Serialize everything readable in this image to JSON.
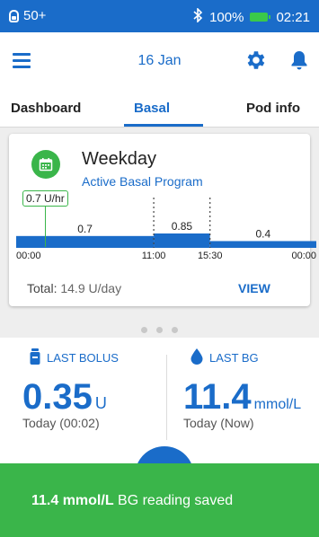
{
  "status_bar": {
    "pod_count": "50+",
    "battery": "100%",
    "time": "02:21"
  },
  "header": {
    "date": "16 Jan"
  },
  "tabs": [
    {
      "label": "Dashboard"
    },
    {
      "label": "Basal"
    },
    {
      "label": "Pod info"
    }
  ],
  "basal_card": {
    "program_name": "Weekday",
    "program_status": "Active Basal Program",
    "current_rate": "0.7 U/hr",
    "total_label": "Total:",
    "total_value": "14.9 U/day",
    "view_label": "VIEW"
  },
  "chart_data": {
    "type": "step",
    "segments": [
      {
        "start": "00:00",
        "end": "11:00",
        "rate": 0.7
      },
      {
        "start": "11:00",
        "end": "15:30",
        "rate": 0.85
      },
      {
        "start": "15:30",
        "end": "24:00",
        "rate": 0.4
      }
    ],
    "tick_labels": [
      "00:00",
      "11:00",
      "15:30",
      "00:00"
    ],
    "value_labels": [
      "0.7",
      "0.85",
      "0.4"
    ],
    "color": "#1a6cc9"
  },
  "last_bolus": {
    "title": "LAST BOLUS",
    "value": "0.35",
    "unit": "U",
    "time": "Today (00:02)"
  },
  "last_bg": {
    "title": "LAST BG",
    "value": "11.4",
    "unit": "mmol/L",
    "time": "Today (Now)"
  },
  "toast": {
    "bold": "11.4 mmol/L",
    "text": " BG reading saved"
  },
  "colors": {
    "primary": "#1a6cc9",
    "success": "#3ab54a"
  }
}
